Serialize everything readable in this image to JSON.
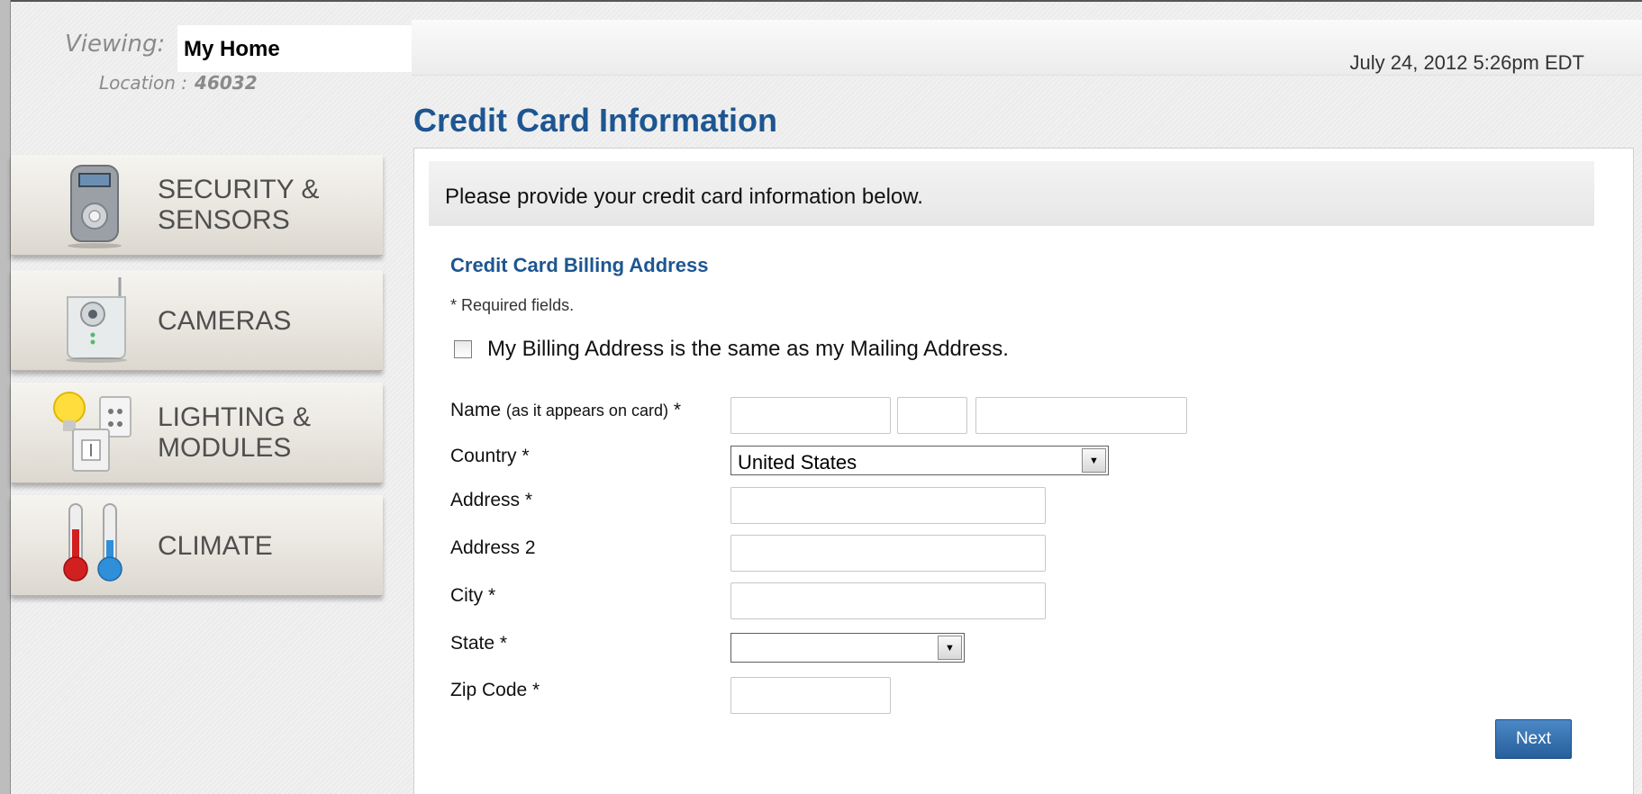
{
  "header": {
    "viewing_label": "Viewing:",
    "home_name": "My Home",
    "location_label": "Location :",
    "location_zip": "46032",
    "datetime": "July 24, 2012  5:26pm EDT"
  },
  "page": {
    "title": "Credit Card Information"
  },
  "sidebar": {
    "items": [
      {
        "label": "SECURITY &\nSENSORS",
        "icon": "keypad-icon"
      },
      {
        "label": "CAMERAS",
        "icon": "camera-icon"
      },
      {
        "label": "LIGHTING &\nMODULES",
        "icon": "lightbulb-outlet-icon"
      },
      {
        "label": "CLIMATE",
        "icon": "thermometer-icon"
      }
    ]
  },
  "form": {
    "intro": "Please provide your credit card information below.",
    "section_title": "Credit Card Billing Address",
    "required_note": "* Required fields.",
    "same_address_label": "My Billing Address is the same as my Mailing Address.",
    "same_address_checked": false,
    "fields": {
      "name_label": "Name",
      "name_note": "(as it appears on card)",
      "name_required": "*",
      "country_label": "Country *",
      "country_value": "United States",
      "address_label": "Address *",
      "address2_label": "Address 2",
      "city_label": "City *",
      "state_label": "State *",
      "state_value": "",
      "zip_label": "Zip Code *"
    },
    "next_label": "Next"
  },
  "colors": {
    "title_blue": "#1d5691",
    "button_blue": "#2f6dab",
    "background": "#ececec"
  }
}
